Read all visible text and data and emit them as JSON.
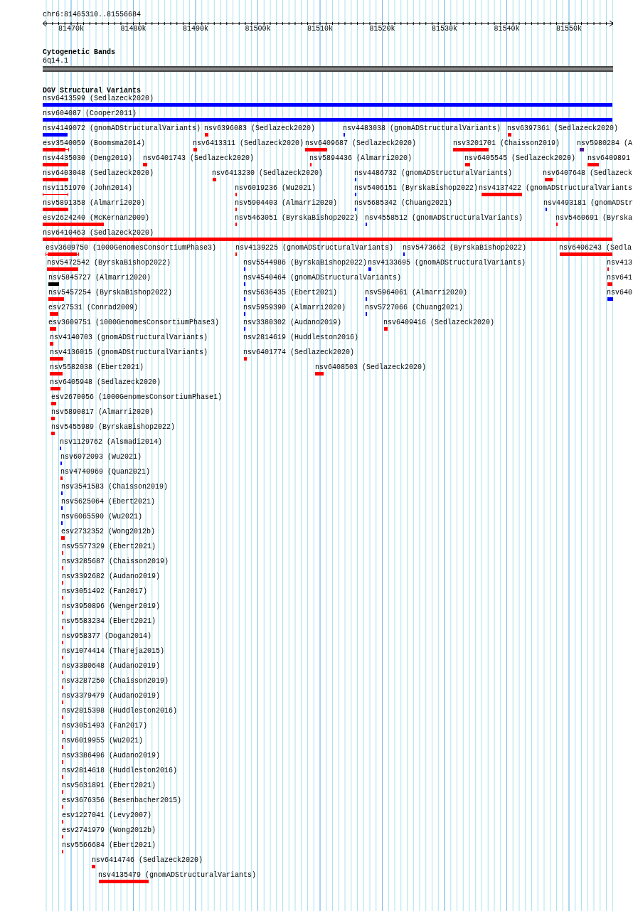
{
  "ruler": {
    "position": "chr6:81465310..81556684",
    "ticks": [
      "81470k",
      "81480k",
      "81490k",
      "81500k",
      "81510k",
      "81520k",
      "81530k",
      "81540k",
      "81550k"
    ]
  },
  "cytogenetic_bands": {
    "title": "Cytogenetic Bands",
    "band": "6q14.1"
  },
  "dgv": {
    "title": "DGV Structural Variants",
    "features": [
      {
        "label": "nsv6413599 (Sedlazeck2020)",
        "color": "#0000ff",
        "kind": "bar"
      },
      {
        "label": "nsv604087 (Cooper2011)",
        "color": "#0000ff",
        "kind": "bar"
      },
      {
        "label": "nsv4149072 (gnomADStructuralVariants)",
        "color": "#0000ff",
        "kind": "bar"
      },
      {
        "label": "nsv6396083 (Sedlazeck2020)",
        "color": "#ff0000",
        "kind": "bar"
      },
      {
        "label": "nsv4483038 (gnomADStructuralVariants)",
        "color": "#0000ff",
        "kind": "bar"
      },
      {
        "label": "nsv6397361 (Sedlazeck2020)",
        "color": "#ff0000",
        "kind": "bar"
      },
      {
        "label": "esv3540059 (Boomsma2014)",
        "color": "#ff0000",
        "kind": "whisker"
      },
      {
        "label": "nsv6413311 (Sedlazeck2020)",
        "color": "#ff0000",
        "kind": "bar"
      },
      {
        "label": "nsv6409687 (Sedlazeck2020)",
        "color": "#ff0000",
        "kind": "bar"
      },
      {
        "label": "nsv3201701 (Chaisson2019)",
        "color": "#ff0000",
        "kind": "bar"
      },
      {
        "label": "nsv5980284 (A",
        "color": "#551a8b",
        "kind": "bar"
      },
      {
        "label": "nsv4435030 (Deng2019)",
        "color": "#ff0000",
        "kind": "bar"
      },
      {
        "label": "nsv6401743 (Sedlazeck2020)",
        "color": "#ff0000",
        "kind": "bar"
      },
      {
        "label": "nsv5894436 (Almarri2020)",
        "color": "#ff0000",
        "kind": "bar"
      },
      {
        "label": "nsv6405545 (Sedlazeck2020)",
        "color": "#ff0000",
        "kind": "bar"
      },
      {
        "label": "nsv6409891",
        "color": "#ff0000",
        "kind": "bar"
      },
      {
        "label": "nsv6403048 (Sedlazeck2020)",
        "color": "#ff0000",
        "kind": "bar"
      },
      {
        "label": "nsv6413230 (Sedlazeck2020)",
        "color": "#ff0000",
        "kind": "bar"
      },
      {
        "label": "nsv4486732 (gnomADStructuralVariants)",
        "color": "#0000ff",
        "kind": "bar"
      },
      {
        "label": "nsv6407648 (Sedlazeck",
        "color": "#ff0000",
        "kind": "bar"
      },
      {
        "label": "nsv1151970 (John2014)",
        "color": "#ff0000",
        "kind": "line"
      },
      {
        "label": "nsv6019236 (Wu2021)",
        "color": "#ff0000",
        "kind": "bar"
      },
      {
        "label": "nsv5406151 (ByrskaBishop2022)",
        "color": "#0000ff",
        "kind": "bar"
      },
      {
        "label": "nsv4137422 (gnomADStructuralVariants",
        "color": "#ff0000",
        "kind": "bar"
      },
      {
        "label": "nsv5891358 (Almarri2020)",
        "color": "#ff0000",
        "kind": "bar"
      },
      {
        "label": "nsv5904403 (Almarri2020)",
        "color": "#ff0000",
        "kind": "bar"
      },
      {
        "label": "nsv5685342 (Chuang2021)",
        "color": "#0000ff",
        "kind": "bar"
      },
      {
        "label": "nsv4493181 (gnomADStr",
        "color": "#0000ff",
        "kind": "bar"
      },
      {
        "label": "esv2624240 (McKernan2009)",
        "color": "#ff0000",
        "kind": "bar"
      },
      {
        "label": "nsv5463051 (ByrskaBishop2022)",
        "color": "#ff0000",
        "kind": "bar"
      },
      {
        "label": "nsv4558512 (gnomADStructuralVariants)",
        "color": "#0000ff",
        "kind": "bar"
      },
      {
        "label": "nsv5460691 (Byrska",
        "color": "#ff0000",
        "kind": "bar"
      },
      {
        "label": "nsv6410463 (Sedlazeck2020)",
        "color": "#ff0000",
        "kind": "bar"
      },
      {
        "label": "esv3609750 (1000GenomesConsortiumPhase3)",
        "color": "#ff0000",
        "kind": "whisker"
      },
      {
        "label": "nsv4139225 (gnomADStructuralVariants)",
        "color": "#ff0000",
        "kind": "bar"
      },
      {
        "label": "nsv5473662 (ByrskaBishop2022)",
        "color": "#0000ff",
        "kind": "bar"
      },
      {
        "label": "nsv6406243 (Sedla",
        "color": "#ff0000",
        "kind": "bar"
      },
      {
        "label": "nsv5472542 (ByrskaBishop2022)",
        "color": "#ff0000",
        "kind": "bar"
      },
      {
        "label": "nsv5544986 (ByrskaBishop2022)",
        "color": "#0000ff",
        "kind": "bar"
      },
      {
        "label": "nsv4133695 (gnomADStructuralVariants)",
        "color": "#0000ff",
        "kind": "bar"
      },
      {
        "label": "nsv413",
        "color": "#ff0000",
        "kind": "bar"
      },
      {
        "label": "nsv5845727 (Almarri2020)",
        "color": "#000000",
        "kind": "bar"
      },
      {
        "label": "nsv4540464 (gnomADStructuralVariants)",
        "color": "#0000ff",
        "kind": "bar"
      },
      {
        "label": "nsv641",
        "color": "#ff0000",
        "kind": "bar"
      },
      {
        "label": "nsv5457254 (ByrskaBishop2022)",
        "color": "#ff0000",
        "kind": "bar"
      },
      {
        "label": "nsv5636435 (Ebert2021)",
        "color": "#0000ff",
        "kind": "bar"
      },
      {
        "label": "nsv5964061 (Almarri2020)",
        "color": "#0000ff",
        "kind": "bar"
      },
      {
        "label": "nsv640",
        "color": "#0000ff",
        "kind": "bar"
      },
      {
        "label": "esv27531 (Conrad2009)",
        "color": "#ff0000",
        "kind": "bar"
      },
      {
        "label": "nsv5959390 (Almarri2020)",
        "color": "#0000ff",
        "kind": "bar"
      },
      {
        "label": "nsv5727066 (Chuang2021)",
        "color": "#0000ff",
        "kind": "bar"
      },
      {
        "label": "esv3609751 (1000GenomesConsortiumPhase3)",
        "color": "#ff0000",
        "kind": "bar"
      },
      {
        "label": "nsv3380302 (Audano2019)",
        "color": "#0000ff",
        "kind": "bar"
      },
      {
        "label": "nsv6409416 (Sedlazeck2020)",
        "color": "#ff0000",
        "kind": "bar"
      },
      {
        "label": "nsv4140703 (gnomADStructuralVariants)",
        "color": "#ff0000",
        "kind": "bar"
      },
      {
        "label": "nsv2814619 (Huddleston2016)",
        "kind": "label"
      },
      {
        "label": "nsv4136015 (gnomADStructuralVariants)",
        "color": "#ff0000",
        "kind": "bar"
      },
      {
        "label": "nsv6401774 (Sedlazeck2020)",
        "color": "#ff0000",
        "kind": "bar"
      },
      {
        "label": "nsv5582038 (Ebert2021)",
        "color": "#ff0000",
        "kind": "bar"
      },
      {
        "label": "nsv6408503 (Sedlazeck2020)",
        "color": "#ff0000",
        "kind": "bar"
      },
      {
        "label": "nsv6405948 (Sedlazeck2020)",
        "color": "#ff0000",
        "kind": "bar"
      },
      {
        "label": "esv2670056 (1000GenomesConsortiumPhase1)",
        "color": "#ff0000",
        "kind": "bar"
      },
      {
        "label": "nsv5890817 (Almarri2020)",
        "color": "#ff0000",
        "kind": "bar"
      },
      {
        "label": "nsv5455989 (ByrskaBishop2022)",
        "color": "#ff0000",
        "kind": "bar"
      },
      {
        "label": "nsv1129762 (Alsmadi2014)",
        "color": "#0000ff",
        "kind": "bar"
      },
      {
        "label": "nsv6072093 (Wu2021)",
        "color": "#0000ff",
        "kind": "bar"
      },
      {
        "label": "nsv4740969 (Quan2021)",
        "color": "#ff0000",
        "kind": "bar"
      },
      {
        "label": "nsv3541583 (Chaisson2019)",
        "color": "#0000ff",
        "kind": "bar"
      },
      {
        "label": "nsv5625064 (Ebert2021)",
        "color": "#0000ff",
        "kind": "bar"
      },
      {
        "label": "nsv6065590 (Wu2021)",
        "color": "#0000ff",
        "kind": "bar"
      },
      {
        "label": "esv2732352 (Wong2012b)",
        "color": "#ff0000",
        "kind": "whisker"
      },
      {
        "label": "nsv5577329 (Ebert2021)",
        "color": "#ff0000",
        "kind": "bar"
      },
      {
        "label": "nsv3285687 (Chaisson2019)",
        "color": "#ff0000",
        "kind": "bar"
      },
      {
        "label": "nsv3392682 (Audano2019)",
        "color": "#ff0000",
        "kind": "bar"
      },
      {
        "label": "nsv3051492 (Fan2017)",
        "color": "#ff0000",
        "kind": "bar"
      },
      {
        "label": "nsv3950896 (Wenger2019)",
        "color": "#ff0000",
        "kind": "bar"
      },
      {
        "label": "nsv5583234 (Ebert2021)",
        "color": "#ff0000",
        "kind": "bar"
      },
      {
        "label": "nsv958377 (Dogan2014)",
        "color": "#ff0000",
        "kind": "bar"
      },
      {
        "label": "nsv1074414 (Thareja2015)",
        "color": "#ff0000",
        "kind": "bar"
      },
      {
        "label": "nsv3380648 (Audano2019)",
        "color": "#ff0000",
        "kind": "bar"
      },
      {
        "label": "nsv3287250 (Chaisson2019)",
        "color": "#ff0000",
        "kind": "bar"
      },
      {
        "label": "nsv3379479 (Audano2019)",
        "color": "#ff0000",
        "kind": "bar"
      },
      {
        "label": "nsv2815398 (Huddleston2016)",
        "color": "#ff0000",
        "kind": "bar"
      },
      {
        "label": "nsv3051493 (Fan2017)",
        "color": "#ff0000",
        "kind": "bar"
      },
      {
        "label": "nsv6019955 (Wu2021)",
        "color": "#ff0000",
        "kind": "bar"
      },
      {
        "label": "nsv3386496 (Audano2019)",
        "color": "#ff0000",
        "kind": "bar"
      },
      {
        "label": "nsv2814618 (Huddleston2016)",
        "color": "#ff0000",
        "kind": "bar"
      },
      {
        "label": "nsv5631891 (Ebert2021)",
        "color": "#ff0000",
        "kind": "bar"
      },
      {
        "label": "esv3676356 (Besenbacher2015)",
        "color": "#ff0000",
        "kind": "bar"
      },
      {
        "label": "esv1227041 (Levy2007)",
        "color": "#ff0000",
        "kind": "bar"
      },
      {
        "label": "esv2741979 (Wong2012b)",
        "color": "#ff0000",
        "kind": "bar"
      },
      {
        "label": "nsv5566684 (Ebert2021)",
        "color": "#ff0000",
        "kind": "bar"
      },
      {
        "label": "nsv6414746 (Sedlazeck2020)",
        "color": "#ff0000",
        "kind": "bar"
      },
      {
        "label": "nsv4135479 (gnomADStructuralVariants)",
        "color": "#ff0000",
        "kind": "bar"
      }
    ]
  }
}
